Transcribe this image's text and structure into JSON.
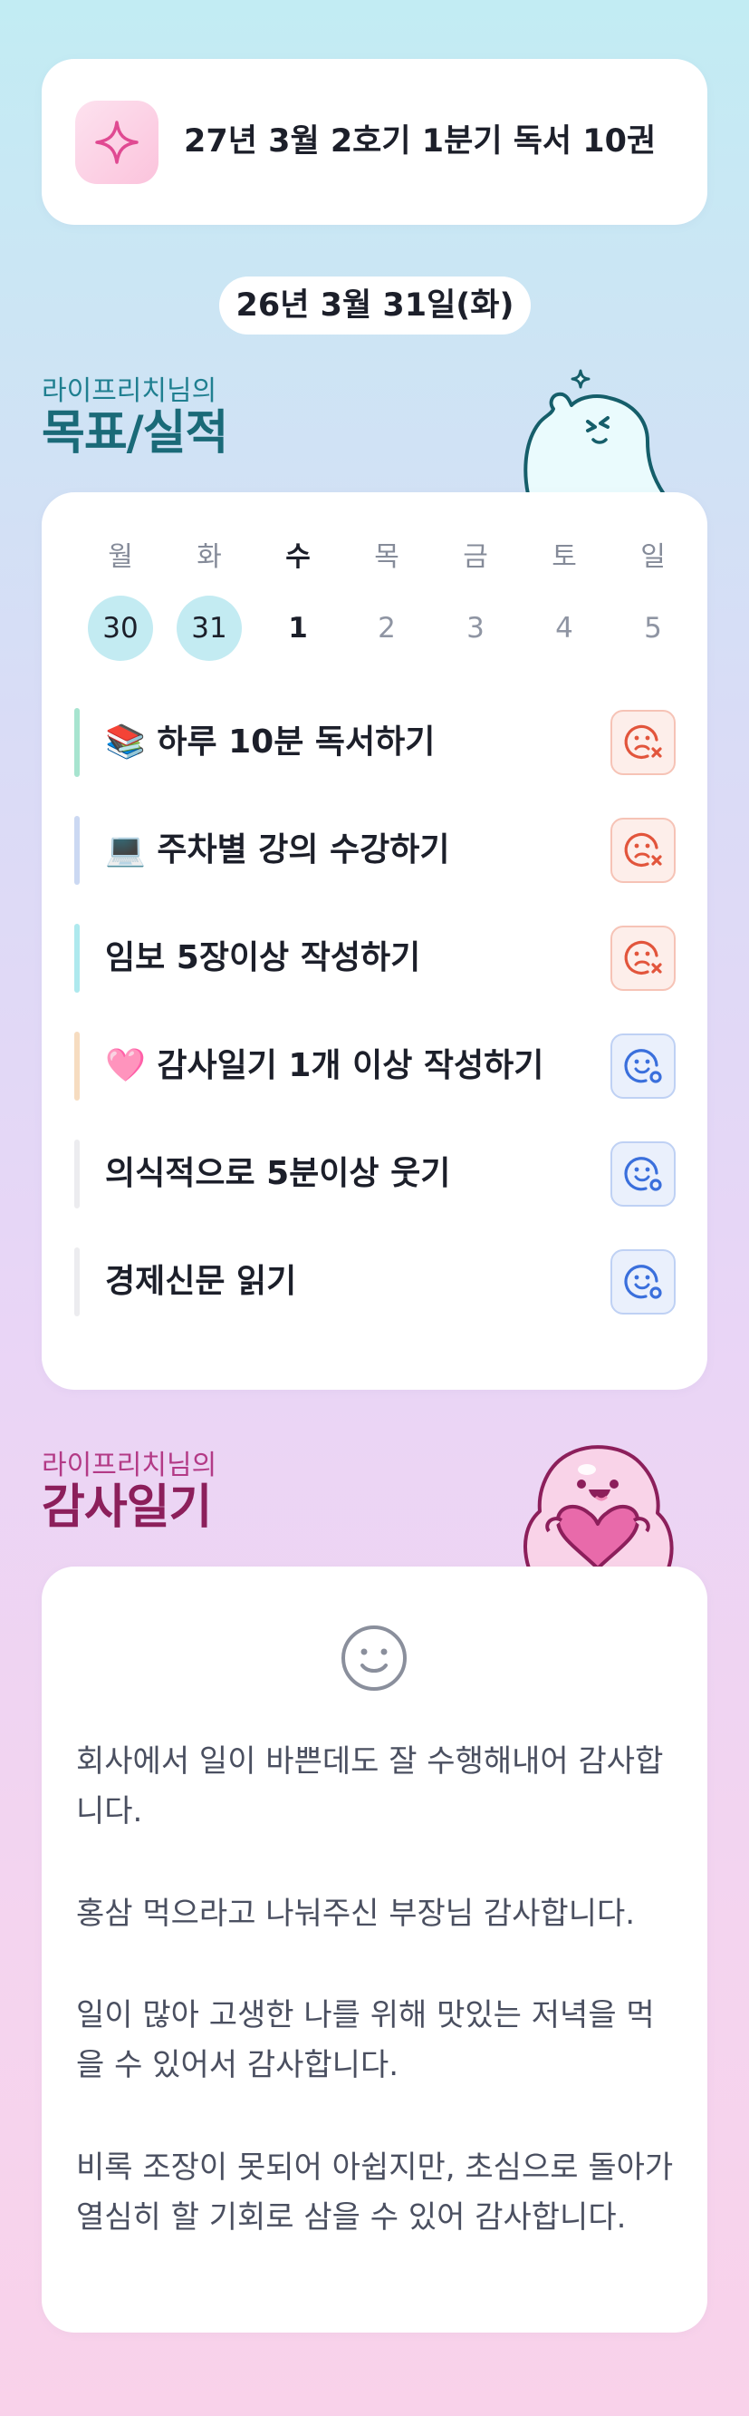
{
  "goal_card": {
    "icon": "sparkle-icon",
    "title": "27년 3월 2호기 1분기 독서 10권"
  },
  "date": "26년 3월 31일(화)",
  "goals_section": {
    "subtitle": "라이프리치님의",
    "title": "목표/실적"
  },
  "week": {
    "days": [
      {
        "dow": "월",
        "date": "30",
        "state": "done"
      },
      {
        "dow": "화",
        "date": "31",
        "state": "done"
      },
      {
        "dow": "수",
        "date": "1",
        "state": "today"
      },
      {
        "dow": "목",
        "date": "2",
        "state": "future"
      },
      {
        "dow": "금",
        "date": "3",
        "state": "future"
      },
      {
        "dow": "토",
        "date": "4",
        "state": "future"
      },
      {
        "dow": "일",
        "date": "5",
        "state": "future"
      }
    ]
  },
  "goals": [
    {
      "label": "📚 하루 10분 독서하기",
      "bar_color": "#a7e4cf",
      "status": "fail",
      "status_icon": "sad-face-x-icon"
    },
    {
      "label": "💻 주차별 강의 수강하기",
      "bar_color": "#cbd8f2",
      "status": "fail",
      "status_icon": "sad-face-x-icon"
    },
    {
      "label": "임보 5장이상 작성하기",
      "bar_color": "#aee9ee",
      "status": "fail",
      "status_icon": "sad-face-x-icon"
    },
    {
      "label": "🩷 감사일기 1개 이상 작성하기",
      "bar_color": "#f6dcc0",
      "status": "ok",
      "status_icon": "happy-face-o-icon"
    },
    {
      "label": "의식적으로 5분이상 웃기",
      "bar_color": "#ececef",
      "status": "ok",
      "status_icon": "happy-face-o-icon"
    },
    {
      "label": "경제신문 읽기",
      "bar_color": "#ececef",
      "status": "ok",
      "status_icon": "happy-face-o-icon"
    }
  ],
  "thanks_section": {
    "subtitle": "라이프리치님의",
    "title": "감사일기"
  },
  "thanks": {
    "icon": "smile-face-icon",
    "entries": [
      "회사에서 일이 바쁜데도 잘 수행해내어 감사합니다.",
      "홍삼 먹으라고 나눠주신 부장님 감사합니다.",
      "일이 많아 고생한 나를 위해 맛있는 저녁을 먹을 수 있어서 감사합니다.",
      "비록 조장이 못되어 아쉽지만, 초심으로 돌아가 열심히 할 기회로 삼을 수 있어 감사합니다."
    ]
  },
  "colors": {
    "accent_teal": "#1a6a78",
    "accent_magenta": "#8c1f5b",
    "fail_red": "#e2553c",
    "ok_blue": "#3a6fdc",
    "done_day": "#c3ebf2"
  }
}
